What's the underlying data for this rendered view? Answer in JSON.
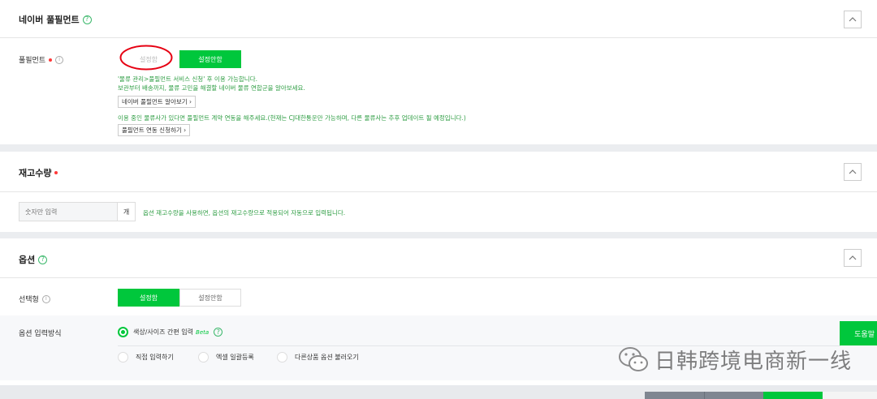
{
  "fulfillment": {
    "title": "네이버 풀필먼트",
    "field_label": "풀필먼트",
    "btn_set": "설정함",
    "btn_unset": "설정안함",
    "notice_line1": "'물류 관리>풀필먼트 서비스 신청' 후 이용 가능합니다.",
    "notice_line2": "보관부터 배송까지, 물류 고민을 해결할 네이버 물류 연합군을 알아보세요.",
    "learn_more_link": "네이버 풀필먼트 알아보기 ›",
    "notice_line3": "이용 중인 물류사가 있다면 풀필먼트 계약 연동을 해주세요.(현재는 CJ대한통운만 가능하며, 다른 물류사는 추후 업데이트 될 예정입니다.)",
    "apply_link": "풀필먼트 연동 신청하기 ›"
  },
  "stock": {
    "title": "재고수량",
    "input_placeholder": "숫자만 입력",
    "unit": "개",
    "help_text": "옵션 재고수량을 사용하면, 옵션의 재고수량으로 적용되어 자동으로 입력됩니다."
  },
  "options": {
    "title": "옵션",
    "select_label": "선택형",
    "btn_set": "설정함",
    "btn_unset": "설정안함",
    "input_method_label": "옵션 입력방식",
    "radio_simple": "색상/사이즈 간편 입력",
    "beta": "Beta",
    "radio_direct": "직접 입력하기",
    "radio_excel": "엑셀 일괄등록",
    "radio_import": "다른상품 옵션 불러오기"
  },
  "floating": {
    "help_button": "도움말",
    "watermark": "日韩跨境电商新一线"
  },
  "colors": {
    "accent_green": "#00c73c",
    "required_red": "#ff3838",
    "annotation_red": "#e60012"
  }
}
